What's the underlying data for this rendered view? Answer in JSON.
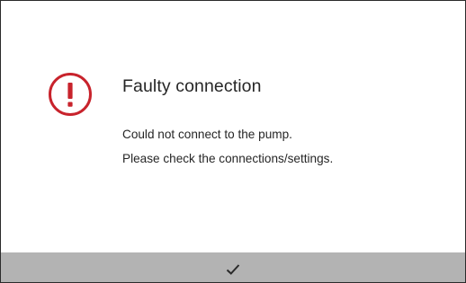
{
  "dialog": {
    "title": "Faulty connection",
    "message_line1": "Could not connect to the pump.",
    "message_line2": "Please check the connections/settings.",
    "icon": "error-exclamation-icon",
    "icon_color": "#c8232c",
    "confirm_icon": "checkmark-icon",
    "footer_color": "#b3b3b3"
  }
}
